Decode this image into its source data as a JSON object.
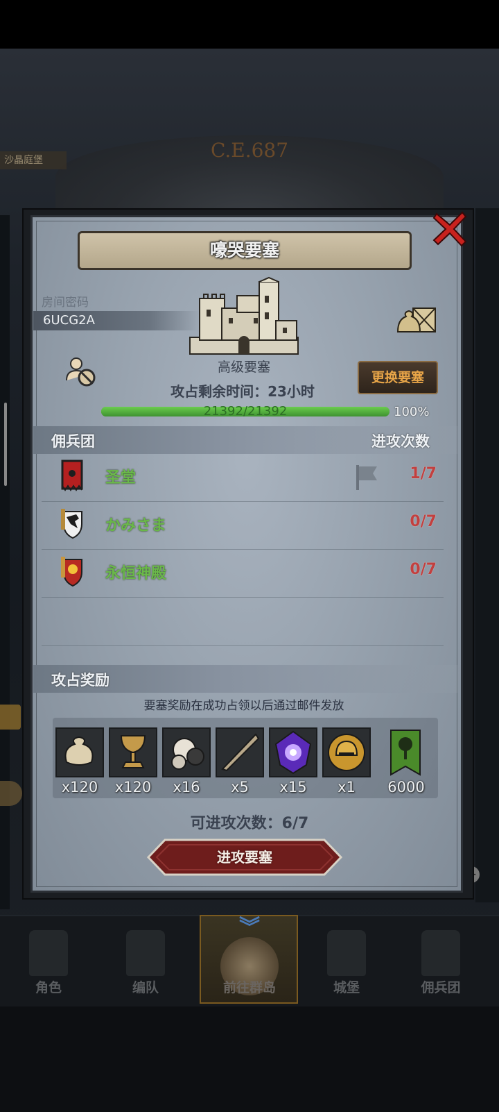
{
  "background": {
    "year_label": "C.E.687",
    "top_left_label": "沙晶庭堡"
  },
  "modal": {
    "title": "嚎哭要塞",
    "room_code_label": "房间密码",
    "room_code": "6UCG2A",
    "fortress_type": "高级要塞",
    "change_button": "更换要塞",
    "remaining_time": "攻占剩余时间：23小时",
    "hp": {
      "current": 21392,
      "max": 21392,
      "text": "21392/21392",
      "percent_text": "100%",
      "fraction": 1.0
    },
    "mercenary_header": "佣兵团",
    "attack_count_header": "进攻次数",
    "mercenaries": [
      {
        "name": "圣堂",
        "attacks": "1/7",
        "emblem": "red-banner-icon"
      },
      {
        "name": "かみさま",
        "attacks": "0/7",
        "emblem": "wolf-shield-icon"
      },
      {
        "name": "永恒神殿",
        "attacks": "0/7",
        "emblem": "sun-shield-icon"
      }
    ],
    "reward_header": "攻占奖励",
    "reward_note": "要塞奖励在成功占领以后通过邮件发放",
    "rewards": [
      {
        "icon": "sack-icon",
        "qty": "x120"
      },
      {
        "icon": "goblet-icon",
        "qty": "x120"
      },
      {
        "icon": "ore-icon",
        "qty": "x16"
      },
      {
        "icon": "horn-icon",
        "qty": "x5"
      },
      {
        "icon": "purple-crystal-icon",
        "qty": "x15"
      },
      {
        "icon": "golden-helmet-icon",
        "qty": "x1"
      },
      {
        "icon": "tree-banner-icon",
        "qty": "6000"
      }
    ],
    "available_attacks": "可进攻次数：6/7",
    "attack_button": "进攻要塞"
  },
  "bottom_nav": [
    {
      "label": "角色",
      "icon": "knight-icon"
    },
    {
      "label": "编队",
      "icon": "helmet-icon"
    },
    {
      "label": "前往群岛",
      "icon": "compass-emblem-icon",
      "active": true
    },
    {
      "label": "城堡",
      "icon": "castle-icon"
    },
    {
      "label": "佣兵团",
      "icon": "ship-icon"
    }
  ],
  "colors": {
    "accent_gold": "#e8a548",
    "name_green": "#6ab84a",
    "count_red": "#c2403f",
    "hp_green": "#4ea33a",
    "button_red": "#6e1d1c"
  }
}
